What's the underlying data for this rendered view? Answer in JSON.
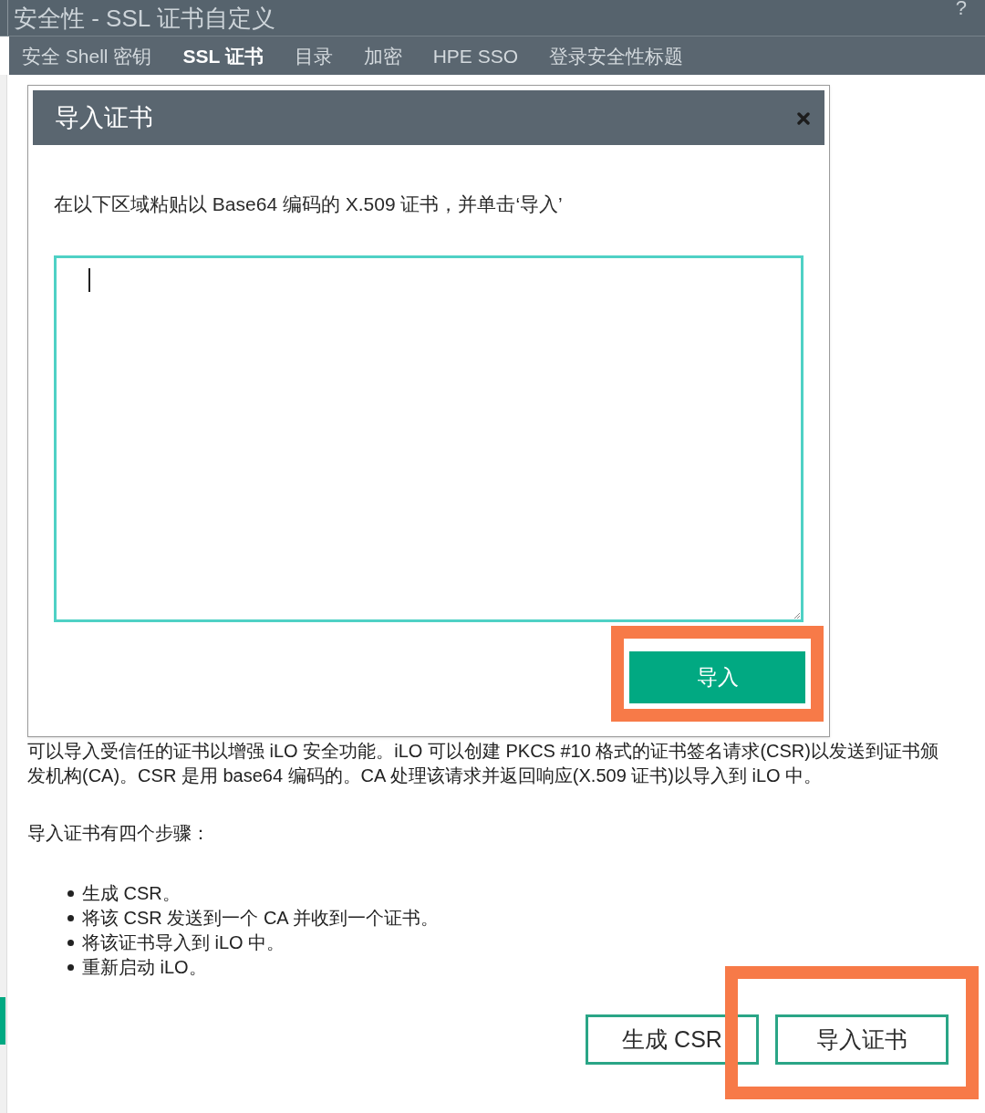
{
  "header": {
    "title": "安全性 - SSL 证书自定义",
    "help": "?"
  },
  "tabs": [
    {
      "label": "安全 Shell 密钥",
      "selected": false
    },
    {
      "label": "SSL 证书",
      "selected": true
    },
    {
      "label": "目录",
      "selected": false
    },
    {
      "label": "加密",
      "selected": false
    },
    {
      "label": "HPE SSO",
      "selected": false
    },
    {
      "label": "登录安全性标题",
      "selected": false
    }
  ],
  "dialog": {
    "title": "导入证书",
    "instruction": "在以下区域粘贴以 Base64 编码的 X.509 证书，并单击‘导入’",
    "certificate_field": {
      "focused": true
    },
    "import_button": {
      "label": "导入",
      "highlighted": true
    }
  },
  "description": "可以导入受信任的证书以增强 iLO 安全功能。iLO 可以创建 PKCS #10 格式的证书签名请求(CSR)以发送到证书颁发机构(CA)。CSR 是用 base64 编码的。CA 处理该请求并返回响应(X.509 证书)以导入到 iLO 中。",
  "steps_heading": "导入证书有四个步骤：",
  "steps": [
    "生成 CSR。",
    "将该 CSR 发送到一个 CA 并收到一个证书。",
    "将该证书导入到 iLO 中。",
    "重新启动 iLO。"
  ],
  "actions": [
    {
      "label": "生成 CSR",
      "highlighted": false
    },
    {
      "label": "导入证书",
      "highlighted": true
    }
  ]
}
